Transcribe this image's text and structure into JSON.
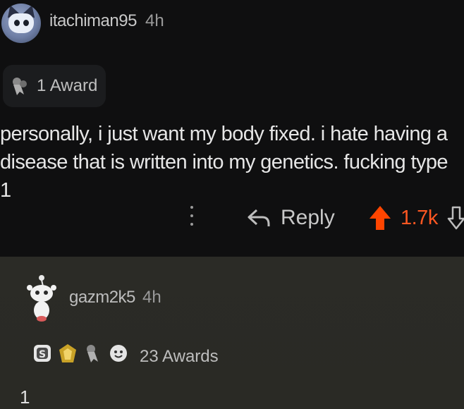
{
  "comment1": {
    "username": "itachiman95",
    "time": "4h",
    "award_label": "1 Award",
    "body": "personally, i just want my body fixed. i hate having a disease that is written into my genetics. fucking type 1",
    "actions": {
      "reply_label": "Reply",
      "score": "1.7k"
    }
  },
  "comment2": {
    "username": "gazm2k5",
    "time": "4h",
    "award_label": "23 Awards",
    "body": "1"
  },
  "colors": {
    "upvote": "#ff4500",
    "score": "#ff5722",
    "reply_panel_bg": "#2b2b26"
  }
}
